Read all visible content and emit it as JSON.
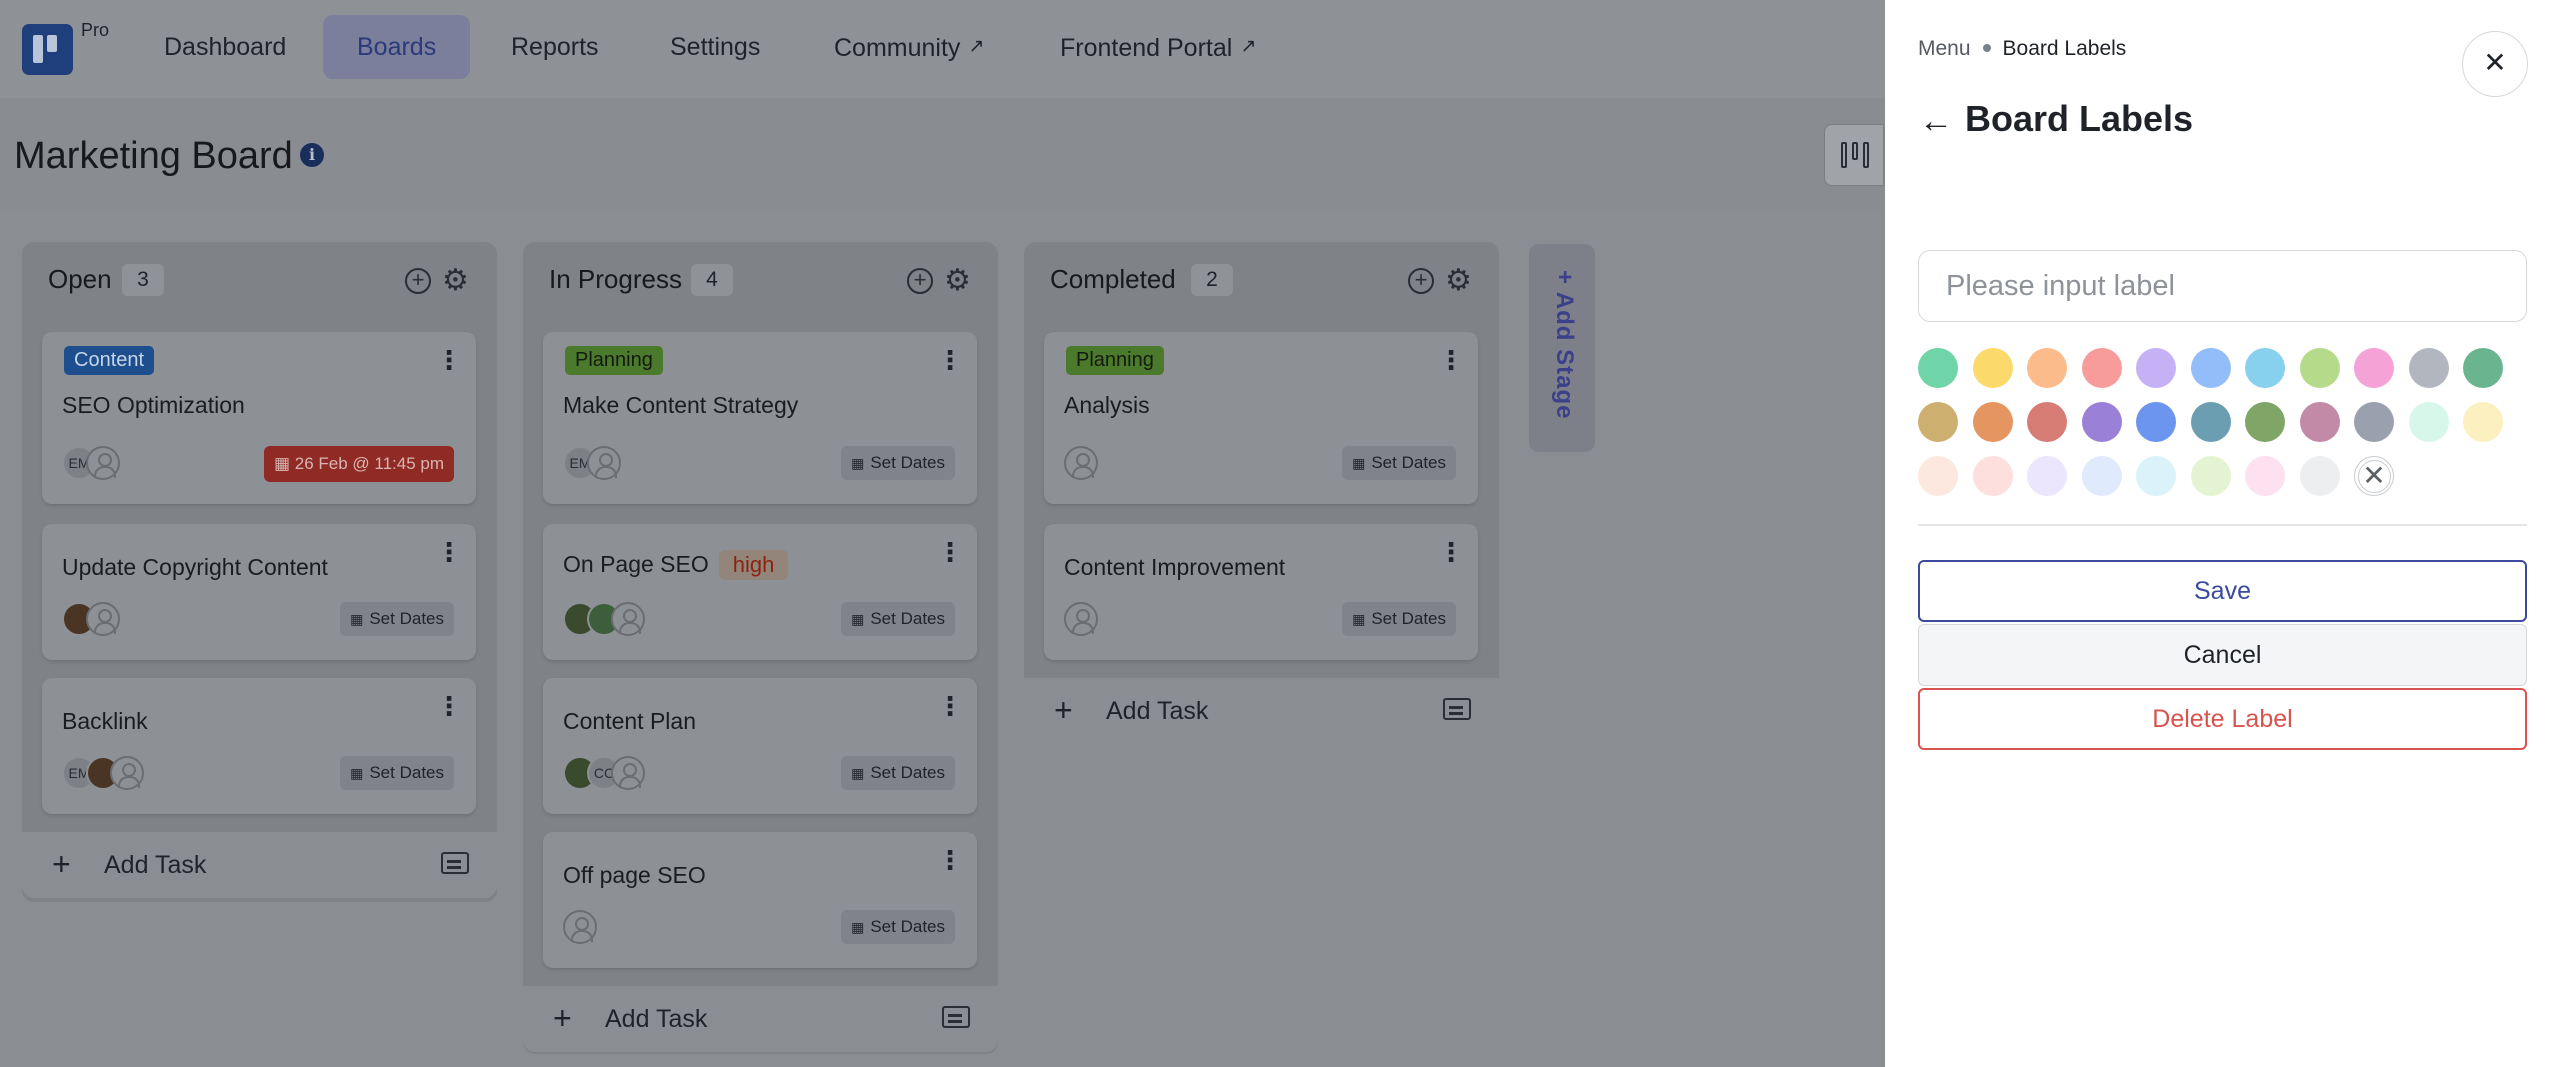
{
  "nav": {
    "pro": "Pro",
    "items": [
      {
        "label": "Dashboard",
        "ext": ""
      },
      {
        "label": "Boards",
        "ext": ""
      },
      {
        "label": "Reports",
        "ext": ""
      },
      {
        "label": "Settings",
        "ext": ""
      },
      {
        "label": "Community",
        "ext": "↗"
      },
      {
        "label": "Frontend Portal",
        "ext": "↗"
      }
    ],
    "active": "Boards"
  },
  "board": {
    "title": "Marketing Board",
    "info_glyph": "i"
  },
  "columns": [
    {
      "title": "Open",
      "count": "3",
      "cards": [
        {
          "label": "Content",
          "title": "SEO Optimization",
          "avatars": [
            "EM",
            ""
          ],
          "date": "26 Feb @ 11:45 pm"
        },
        {
          "label": "",
          "title": "Update Copyright Content",
          "avatars": [
            "",
            ""
          ],
          "date": "Set Dates"
        },
        {
          "label": "",
          "title": "Backlink",
          "avatars": [
            "EM",
            "",
            ""
          ],
          "date": "Set Dates"
        }
      ]
    },
    {
      "title": "In Progress",
      "count": "4",
      "cards": [
        {
          "label": "Planning",
          "title": "Make Content Strategy",
          "avatars": [
            "EM",
            ""
          ],
          "date": "Set Dates"
        },
        {
          "label": "",
          "title": "On Page SEO",
          "priority": "high",
          "avatars": [
            "",
            "",
            ""
          ],
          "date": "Set Dates"
        },
        {
          "label": "",
          "title": "Content Plan",
          "avatars": [
            "",
            "CC",
            ""
          ],
          "date": "Set Dates"
        },
        {
          "label": "",
          "title": "Off page SEO",
          "avatars": [
            ""
          ],
          "date": "Set Dates"
        }
      ]
    },
    {
      "title": "Completed",
      "count": "2",
      "cards": [
        {
          "label": "Planning",
          "title": "Analysis",
          "avatars": [
            ""
          ],
          "date": "Set Dates"
        },
        {
          "label": "",
          "title": "Content Improvement",
          "avatars": [
            ""
          ],
          "date": "Set Dates"
        }
      ]
    }
  ],
  "add_task_label": "Add Task",
  "add_stage_label": "+ Add Stage",
  "drawer": {
    "breadcrumb_menu": "Menu",
    "breadcrumb_current": "Board Labels",
    "close_glyph": "✕",
    "back_glyph": "←",
    "title": "Board Labels",
    "input_placeholder": "Please input label",
    "clear_glyph": "✕",
    "save_label": "Save",
    "cancel_label": "Cancel",
    "delete_label": "Delete Label",
    "swatches": [
      [
        "#6fd4a7",
        "#fbd96a",
        "#fcbb8b",
        "#f79b9b",
        "#c4b1f6",
        "#93bdf9",
        "#87d1ee",
        "#b5db8a",
        "#f5a3d6",
        "#b2b6bf",
        "#6ab58f"
      ],
      [
        "#cdb070",
        "#e5955f",
        "#d77b75",
        "#9a80d6",
        "#6b95ee",
        "#6b9eb0",
        "#7fa567",
        "#c38aa8",
        "#9aa0ad",
        "#d6f7e9",
        "#fdf0c0"
      ],
      [
        "#fde8df",
        "#fde0de",
        "#ebe6fd",
        "#e0eafd",
        "#dbf2fb",
        "#e4f4d2",
        "#fde1f0",
        "#eceef0"
      ]
    ]
  }
}
